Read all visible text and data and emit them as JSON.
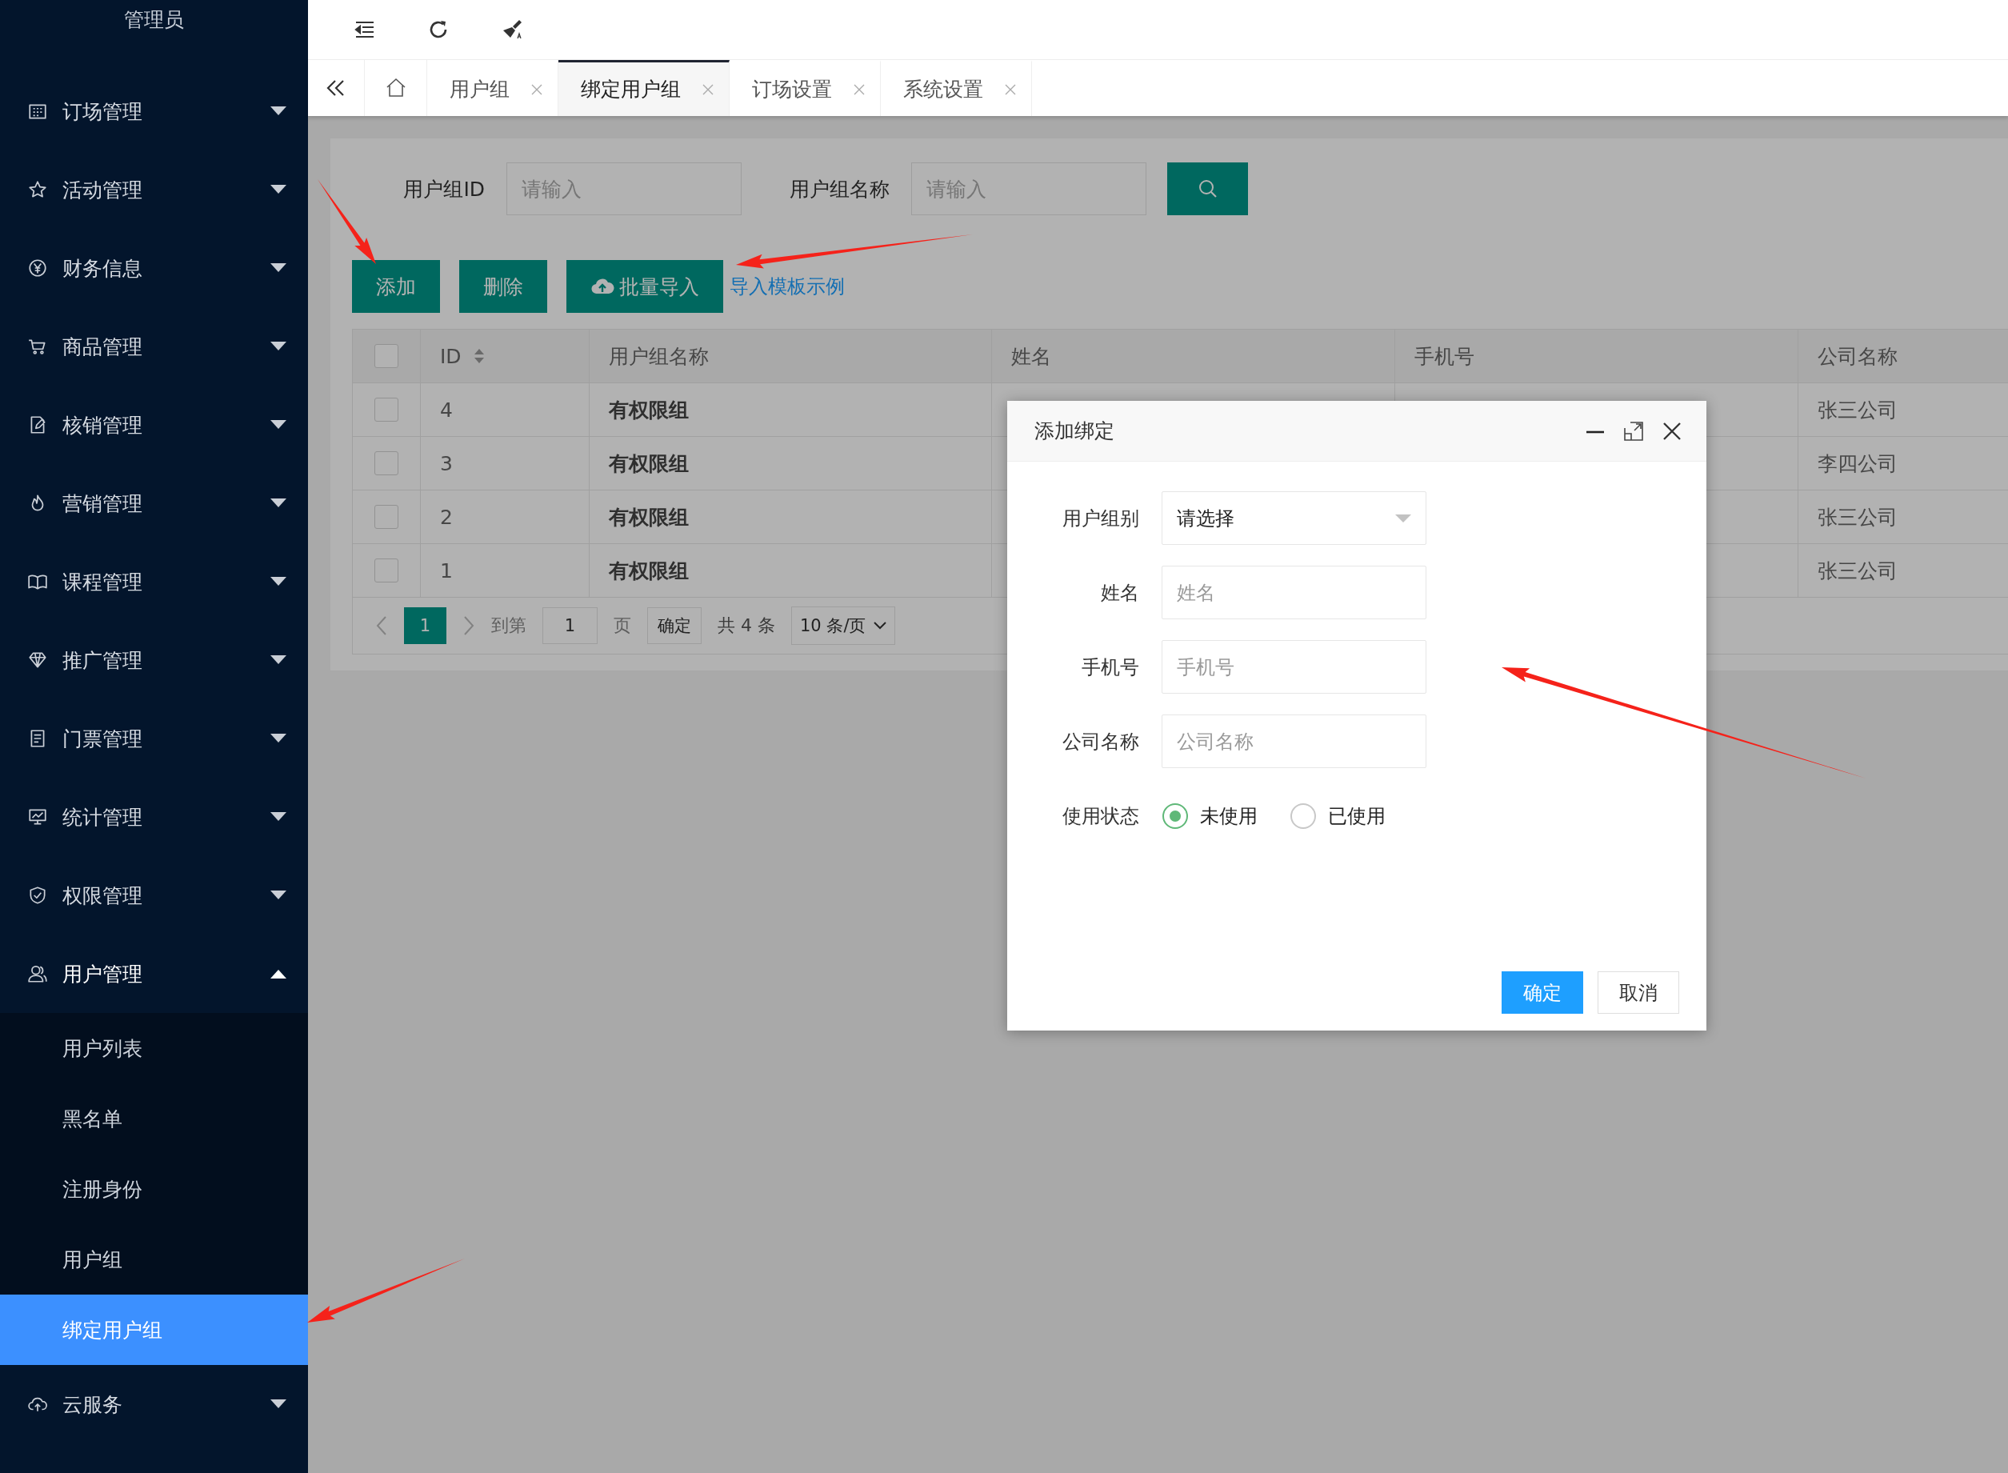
{
  "sidebar": {
    "title": "管理员",
    "items": [
      {
        "label": "订场管理",
        "expanded": false
      },
      {
        "label": "活动管理",
        "expanded": false
      },
      {
        "label": "财务信息",
        "expanded": false
      },
      {
        "label": "商品管理",
        "expanded": false
      },
      {
        "label": "核销管理",
        "expanded": false
      },
      {
        "label": "营销管理",
        "expanded": false
      },
      {
        "label": "课程管理",
        "expanded": false
      },
      {
        "label": "推广管理",
        "expanded": false
      },
      {
        "label": "门票管理",
        "expanded": false
      },
      {
        "label": "统计管理",
        "expanded": false
      },
      {
        "label": "权限管理",
        "expanded": false
      },
      {
        "label": "用户管理",
        "expanded": true,
        "children": [
          {
            "label": "用户列表",
            "selected": false
          },
          {
            "label": "黑名单",
            "selected": false
          },
          {
            "label": "注册身份",
            "selected": false
          },
          {
            "label": "用户组",
            "selected": false
          },
          {
            "label": "绑定用户组",
            "selected": true
          }
        ]
      },
      {
        "label": "云服务",
        "expanded": false
      }
    ]
  },
  "tabs": [
    {
      "label": "用户组",
      "selected": false
    },
    {
      "label": "绑定用户组",
      "selected": true
    },
    {
      "label": "订场设置",
      "selected": false
    },
    {
      "label": "系统设置",
      "selected": false
    }
  ],
  "search": {
    "fields": [
      {
        "label": "用户组ID",
        "placeholder": "请输入"
      },
      {
        "label": "用户组名称",
        "placeholder": "请输入"
      }
    ]
  },
  "actions": {
    "buttons": [
      {
        "label": "添加",
        "kind": "plain"
      },
      {
        "label": "删除",
        "kind": "plain"
      },
      {
        "label": "批量导入",
        "kind": "upload"
      }
    ],
    "link": "导入模板示例"
  },
  "table": {
    "all_checked": false,
    "columns": [
      "ID",
      "用户组名称",
      "姓名",
      "手机号",
      "公司名称"
    ],
    "rows": [
      {
        "checked": false,
        "id": "4",
        "group_name": "有权限组",
        "company": "张三公司"
      },
      {
        "checked": false,
        "id": "3",
        "group_name": "有权限组",
        "company": "李四公司"
      },
      {
        "checked": false,
        "id": "2",
        "group_name": "有权限组",
        "company": "张三公司"
      },
      {
        "checked": false,
        "id": "1",
        "group_name": "有权限组",
        "company": "张三公司"
      }
    ]
  },
  "pagination": {
    "pages": [
      {
        "label": "1",
        "selected": true
      }
    ],
    "goto_label": "到第",
    "goto_value": "1",
    "page_unit": "页",
    "confirm": "确定",
    "total": "共 4 条",
    "page_size": "10 条/页"
  },
  "dialog": {
    "title": "添加绑定",
    "fields": [
      {
        "kind": "select",
        "label": "用户组别",
        "value": "请选择"
      },
      {
        "kind": "text",
        "label": "姓名",
        "placeholder": "姓名"
      },
      {
        "kind": "text",
        "label": "手机号",
        "placeholder": "手机号"
      },
      {
        "kind": "text",
        "label": "公司名称",
        "placeholder": "公司名称"
      },
      {
        "kind": "radio",
        "label": "使用状态",
        "options": [
          {
            "label": "未使用",
            "selected": true
          },
          {
            "label": "已使用",
            "selected": false
          }
        ]
      }
    ],
    "buttons": [
      {
        "label": "确定",
        "kind": "primary"
      },
      {
        "label": "取消",
        "kind": "default"
      }
    ]
  }
}
